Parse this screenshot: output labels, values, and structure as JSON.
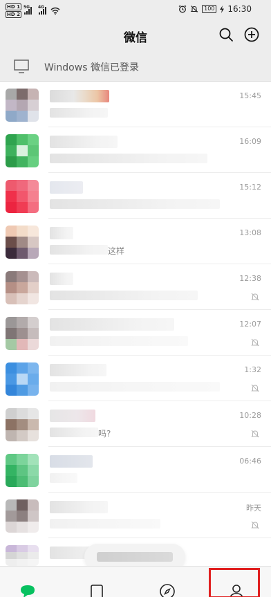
{
  "status_bar": {
    "sim1_label": "HD",
    "sim1_index": "1",
    "sim2_label": "HD",
    "sim2_index": "2",
    "network1": "5G",
    "network2": "4G",
    "battery": "100",
    "time": "16:30"
  },
  "header": {
    "title": "微信",
    "search_icon": "search-icon",
    "add_icon": "plus-circle-icon"
  },
  "login_banner": {
    "icon": "monitor-icon",
    "text": "Windows 微信已登录"
  },
  "chats": [
    {
      "time": "15:45",
      "muted": false,
      "msg_suffix": ""
    },
    {
      "time": "16:09",
      "muted": false,
      "msg_suffix": ""
    },
    {
      "time": "15:12",
      "muted": false,
      "msg_suffix": ""
    },
    {
      "time": "13:08",
      "muted": false,
      "msg_suffix": "这样"
    },
    {
      "time": "12:38",
      "muted": true,
      "msg_suffix": ""
    },
    {
      "time": "12:07",
      "muted": true,
      "msg_suffix": ""
    },
    {
      "time": "1:32",
      "muted": true,
      "msg_suffix": ""
    },
    {
      "time": "10:28",
      "muted": true,
      "msg_suffix": "吗?"
    },
    {
      "time": "06:46",
      "muted": false,
      "msg_suffix": ""
    },
    {
      "time": "昨天",
      "muted": true,
      "msg_suffix": ""
    }
  ],
  "tab_bar": {
    "tabs": [
      {
        "name": "chats",
        "icon": "chat-icon"
      },
      {
        "name": "contacts",
        "icon": "contacts-icon"
      },
      {
        "name": "discover",
        "icon": "compass-icon"
      },
      {
        "name": "me",
        "icon": "person-icon"
      }
    ],
    "highlighted_tab": "me"
  },
  "colors": {
    "accent_green": "#07c160",
    "highlight_red": "#e02020",
    "background": "#ededed"
  }
}
